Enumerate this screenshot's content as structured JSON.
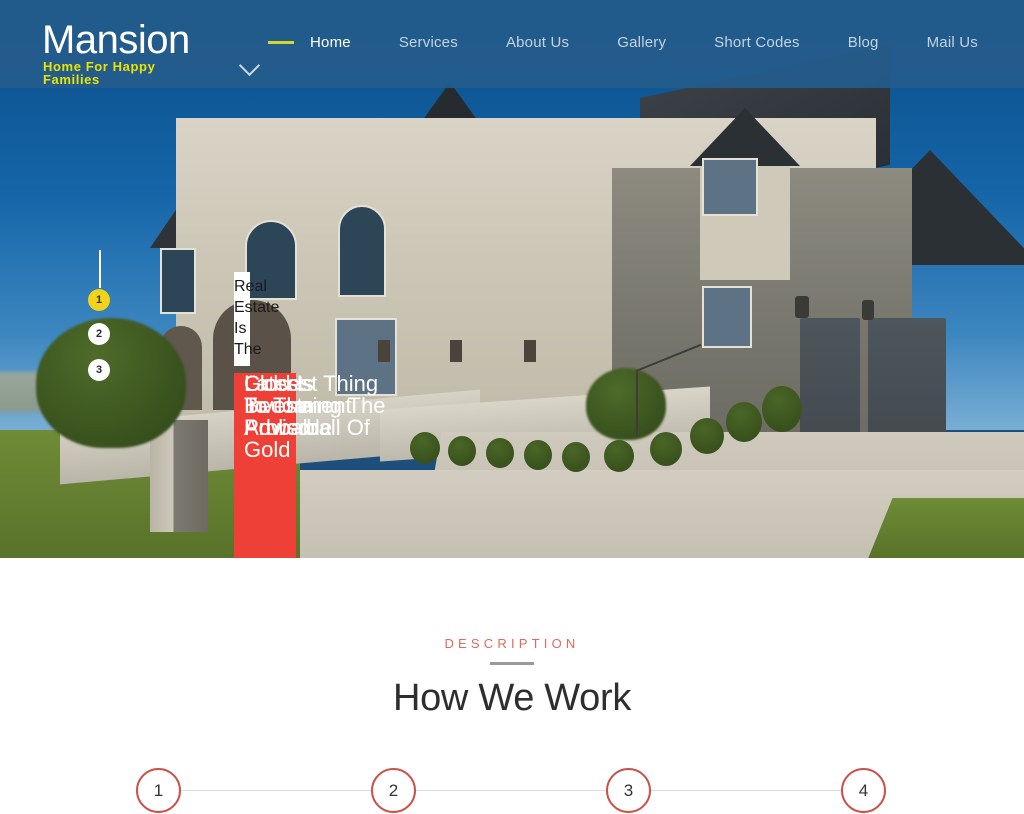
{
  "header": {
    "logo_title": "Mansion",
    "logo_tagline": "Home For Happy Families",
    "caret_icon": "chevron-down-icon",
    "nav": [
      {
        "label": "Home",
        "active": true
      },
      {
        "label": "Services",
        "active": false
      },
      {
        "label": "About Us",
        "active": false
      },
      {
        "label": "Gallery",
        "active": false
      },
      {
        "label": "Short Codes",
        "active": false
      },
      {
        "label": "Blog",
        "active": false
      },
      {
        "label": "Mail Us",
        "active": false
      }
    ]
  },
  "hero": {
    "captions": {
      "subtitle": "Real Estate Is The",
      "title_line_1": "Gold Is Becoming The Probable",
      "title_line_2": "Latest Investment Advisor",
      "title_line_3": "Closest Thing To The Powerball Of Gold"
    },
    "bullets": [
      {
        "label": "1",
        "active": true
      },
      {
        "label": "2",
        "active": false
      },
      {
        "label": "3",
        "active": false
      }
    ]
  },
  "description": {
    "eyebrow": "DESCRIPTION",
    "title": "How We Work",
    "steps": [
      {
        "label": "1"
      },
      {
        "label": "2"
      },
      {
        "label": "3"
      },
      {
        "label": "4"
      }
    ]
  },
  "colors": {
    "header_bg": "#245c8c",
    "accent_yellow": "#ece400",
    "accent_red": "#ee4036",
    "eyebrow_red": "#e06a5b",
    "step_border": "#c9524a",
    "bullet_active": "#f2d31b"
  }
}
